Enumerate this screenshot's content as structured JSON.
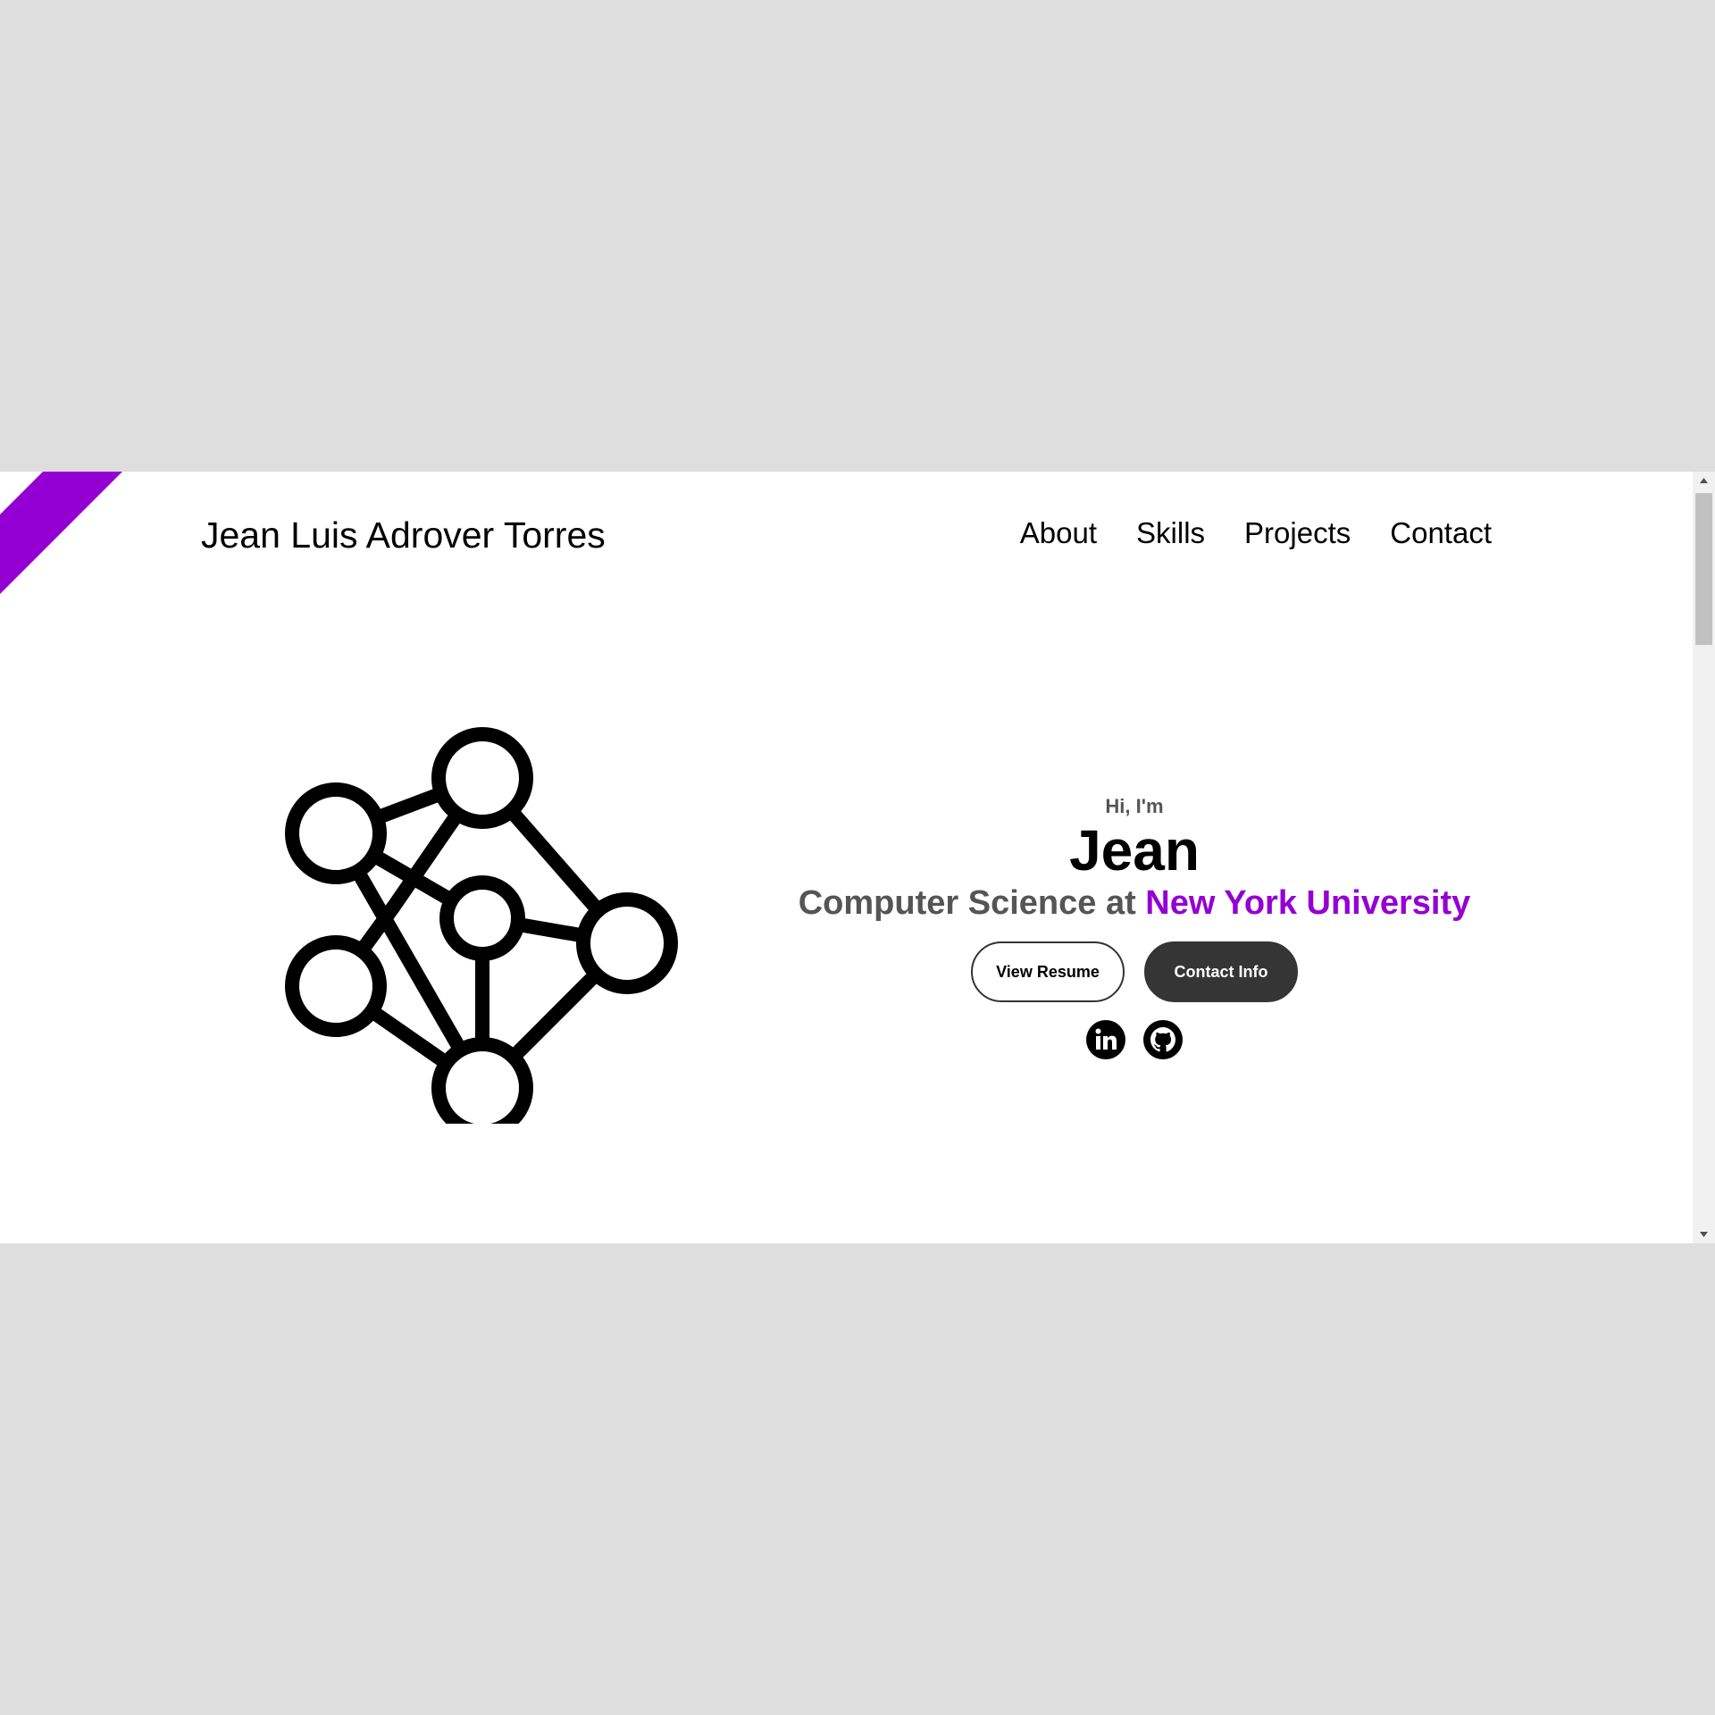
{
  "header": {
    "site_title": "Jean Luis Adrover Torres",
    "nav": [
      {
        "label": "About"
      },
      {
        "label": "Skills"
      },
      {
        "label": "Projects"
      },
      {
        "label": "Contact"
      }
    ]
  },
  "hero": {
    "greeting": "Hi, I'm",
    "name": "Jean",
    "subtitle_prefix": "Computer Science at ",
    "subtitle_university": "New York University",
    "buttons": {
      "resume_label": "View Resume",
      "contact_label": "Contact Info"
    },
    "socials": [
      {
        "icon": "linkedin-icon"
      },
      {
        "icon": "github-icon"
      }
    ],
    "graphic_icon": "network-graph-icon"
  },
  "colors": {
    "accent": "#9400d3",
    "page_background": "#dedede",
    "content_background": "#ffffff",
    "button_dark": "#353535",
    "muted_text": "#555555"
  }
}
